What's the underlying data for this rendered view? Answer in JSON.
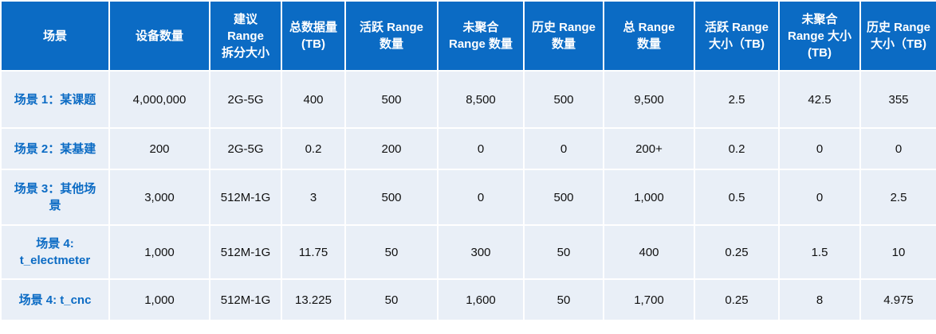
{
  "headers": [
    "场景",
    "设备数量",
    "建议\nRange\n拆分大小",
    "总数据量\n(TB)",
    "活跃 Range\n数量",
    "未聚合\nRange 数量",
    "历史 Range\n数量",
    "总 Range\n数量",
    "活跃 Range\n大小（TB)",
    "未聚合\nRange 大小\n(TB)",
    "历史 Range\n大小（TB)"
  ],
  "rows": [
    [
      "场景 1：某课题",
      "4,000,000",
      "2G-5G",
      "400",
      "500",
      "8,500",
      "500",
      "9,500",
      "2.5",
      "42.5",
      "355"
    ],
    [
      "场景 2：某基建",
      "200",
      "2G-5G",
      "0.2",
      "200",
      "0",
      "0",
      "200+",
      "0.2",
      "0",
      "0"
    ],
    [
      "场景 3：其他场\n景",
      "3,000",
      "512M-1G",
      "3",
      "500",
      "0",
      "500",
      "1,000",
      "0.5",
      "0",
      "2.5"
    ],
    [
      "场景 4:\nt_electmeter",
      "1,000",
      "512M-1G",
      "11.75",
      "50",
      "300",
      "50",
      "400",
      "0.25",
      "1.5",
      "10"
    ],
    [
      "场景 4: t_cnc",
      "1,000",
      "512M-1G",
      "13.225",
      "50",
      "1,600",
      "50",
      "1,700",
      "0.25",
      "8",
      "4.975"
    ]
  ],
  "colors": {
    "header_bg": "#0b6bc4",
    "header_text": "#ffffff",
    "cell_bg": "#e9eff7",
    "scene_text": "#0b6bc4"
  }
}
